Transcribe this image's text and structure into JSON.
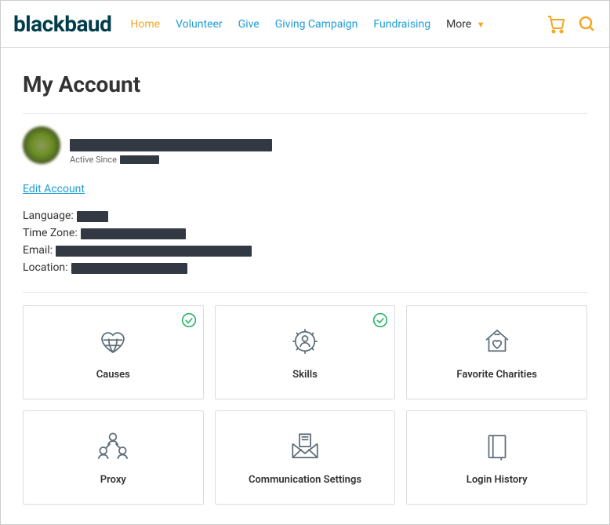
{
  "brand": "blackbaud",
  "nav": {
    "items": [
      {
        "label": "Home",
        "active": true
      },
      {
        "label": "Volunteer"
      },
      {
        "label": "Give"
      },
      {
        "label": "Giving Campaign"
      },
      {
        "label": "Fundraising"
      }
    ],
    "more_label": "More"
  },
  "page": {
    "title": "My Account",
    "active_since_label": "Active Since",
    "edit_link": "Edit Account",
    "fields": {
      "language_label": "Language:",
      "timezone_label": "Time Zone:",
      "email_label": "Email:",
      "location_label": "Location:"
    }
  },
  "cards": [
    {
      "label": "Causes",
      "checked": true
    },
    {
      "label": "Skills",
      "checked": true
    },
    {
      "label": "Favorite Charities",
      "checked": false
    },
    {
      "label": "Proxy",
      "checked": false
    },
    {
      "label": "Communication Settings",
      "checked": false
    },
    {
      "label": "Login History",
      "checked": false
    }
  ]
}
